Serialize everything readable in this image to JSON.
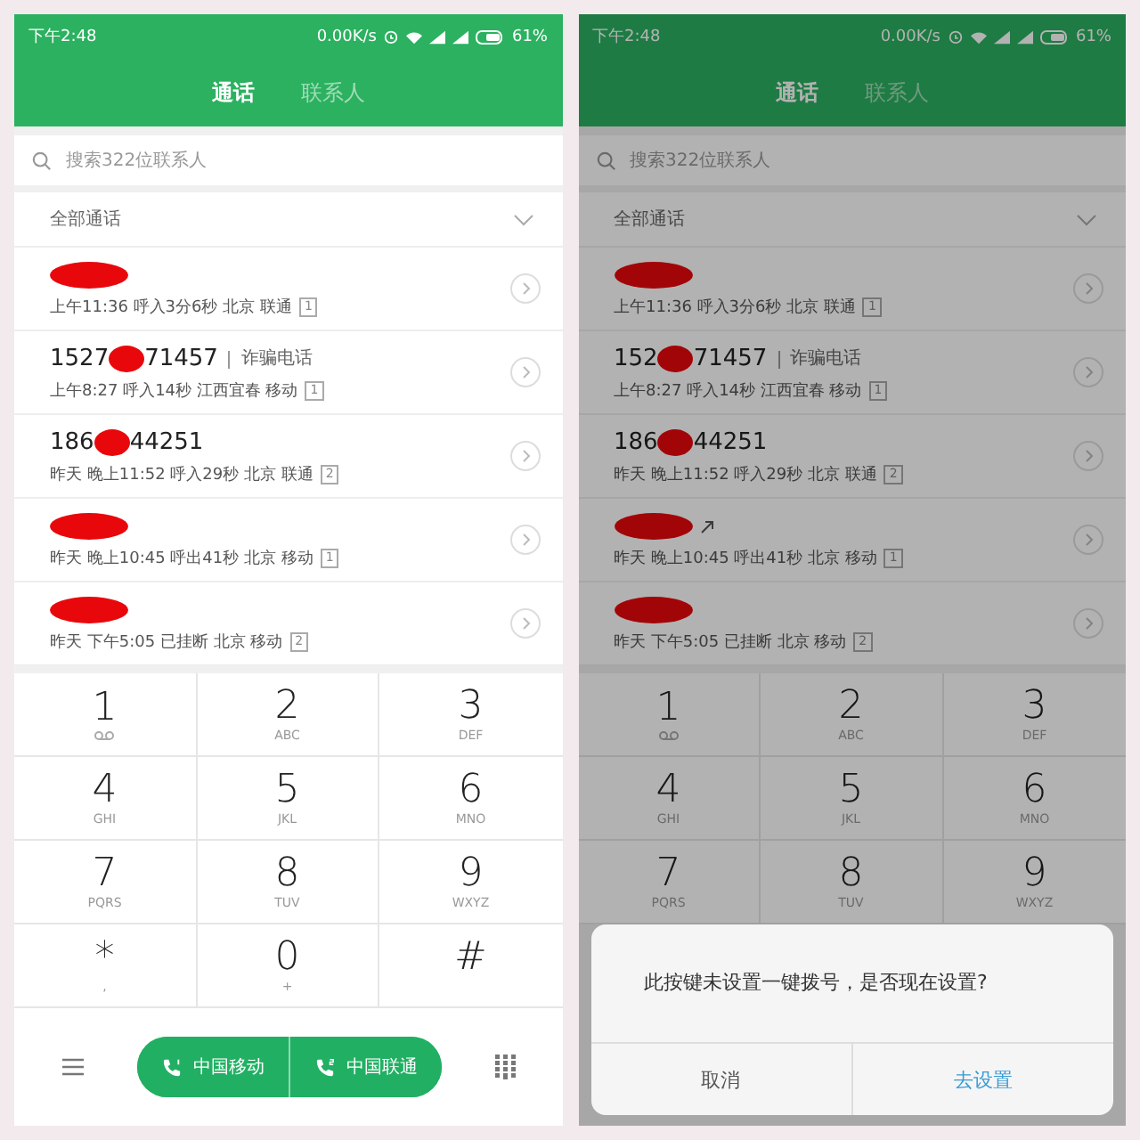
{
  "screens": [
    {
      "dimmed": false,
      "status_bar": {
        "time": "下午2:48",
        "speed": "0.00K/s",
        "battery": "61%"
      },
      "tabs": [
        {
          "label": "通话",
          "selected": true
        },
        {
          "label": "联系人",
          "selected": false
        }
      ],
      "search": {
        "placeholder": "搜索322位联系人"
      },
      "filter": {
        "label": "全部通话"
      },
      "calls": [
        {
          "name": {
            "kind": "redacted"
          },
          "detail": "上午11:36 呼入3分6秒 北京 联通",
          "sim": "1",
          "outgoing": false
        },
        {
          "name": {
            "kind": "number",
            "parts": [
              "1527",
              "71457"
            ]
          },
          "tag": "诈骗电话",
          "detail": "上午8:27 呼入14秒 江西宜春 移动",
          "sim": "1",
          "outgoing": false
        },
        {
          "name": {
            "kind": "number",
            "parts": [
              "186",
              "44251"
            ]
          },
          "detail": "昨天 晚上11:52 呼入29秒 北京 联通",
          "sim": "2",
          "outgoing": false
        },
        {
          "name": {
            "kind": "redacted"
          },
          "detail": "昨天 晚上10:45 呼出41秒 北京 移动",
          "sim": "1",
          "outgoing": false
        },
        {
          "name": {
            "kind": "redacted"
          },
          "detail": "昨天 下午5:05 已挂断 北京 移动",
          "sim": "2",
          "outgoing": false
        }
      ],
      "keys": [
        {
          "digit": "1",
          "kind": "voicemail"
        },
        {
          "digit": "2",
          "kind": "letters",
          "letters": "ABC"
        },
        {
          "digit": "3",
          "kind": "letters",
          "letters": "DEF"
        },
        {
          "digit": "4",
          "kind": "letters",
          "letters": "GHI"
        },
        {
          "digit": "5",
          "kind": "letters",
          "letters": "JKL"
        },
        {
          "digit": "6",
          "kind": "letters",
          "letters": "MNO"
        },
        {
          "digit": "7",
          "kind": "letters",
          "letters": "PQRS"
        },
        {
          "digit": "8",
          "kind": "letters",
          "letters": "TUV"
        },
        {
          "digit": "9",
          "kind": "letters",
          "letters": "WXYZ"
        },
        {
          "digit": "*",
          "kind": "letters",
          "letters": ","
        },
        {
          "digit": "0",
          "kind": "letters",
          "letters": "+"
        },
        {
          "digit": "#",
          "kind": "letters"
        }
      ],
      "call_buttons": [
        {
          "label": "中国移动",
          "kind": "sim1"
        },
        {
          "label": "中国联通",
          "kind": "sim2"
        }
      ]
    },
    {
      "dimmed": true,
      "status_bar": {
        "time": "下午2:48",
        "speed": "0.00K/s",
        "battery": "61%"
      },
      "tabs": [
        {
          "label": "通话",
          "selected": true
        },
        {
          "label": "联系人",
          "selected": false
        }
      ],
      "search": {
        "placeholder": "搜索322位联系人"
      },
      "filter": {
        "label": "全部通话"
      },
      "calls": [
        {
          "name": {
            "kind": "redacted"
          },
          "detail": "上午11:36 呼入3分6秒 北京 联通",
          "sim": "1",
          "outgoing": false
        },
        {
          "name": {
            "kind": "number",
            "parts": [
              "152",
              "71457"
            ]
          },
          "tag": "诈骗电话",
          "detail": "上午8:27 呼入14秒 江西宜春 移动",
          "sim": "1",
          "outgoing": false
        },
        {
          "name": {
            "kind": "number",
            "parts": [
              "186",
              "44251"
            ]
          },
          "detail": "昨天 晚上11:52 呼入29秒 北京 联通",
          "sim": "2",
          "outgoing": false
        },
        {
          "name": {
            "kind": "redacted"
          },
          "detail": "昨天 晚上10:45 呼出41秒 北京 移动",
          "sim": "1",
          "outgoing": true
        },
        {
          "name": {
            "kind": "redacted"
          },
          "detail": "昨天 下午5:05 已挂断 北京 移动",
          "sim": "2",
          "outgoing": false
        }
      ],
      "keys": [
        {
          "digit": "1",
          "kind": "voicemail"
        },
        {
          "digit": "2",
          "kind": "letters",
          "letters": "ABC"
        },
        {
          "digit": "3",
          "kind": "letters",
          "letters": "DEF"
        },
        {
          "digit": "4",
          "kind": "letters",
          "letters": "GHI"
        },
        {
          "digit": "5",
          "kind": "letters",
          "letters": "JKL"
        },
        {
          "digit": "6",
          "kind": "letters",
          "letters": "MNO"
        },
        {
          "digit": "7",
          "kind": "letters",
          "letters": "PQRS"
        },
        {
          "digit": "8",
          "kind": "letters",
          "letters": "TUV"
        },
        {
          "digit": "9",
          "kind": "letters",
          "letters": "WXYZ"
        }
      ],
      "dialog": {
        "message": "此按键未设置一键拨号，是否现在设置?",
        "buttons": [
          {
            "label": "取消",
            "kind": "cancel"
          },
          {
            "label": "去设置",
            "kind": "confirm"
          }
        ]
      }
    }
  ]
}
